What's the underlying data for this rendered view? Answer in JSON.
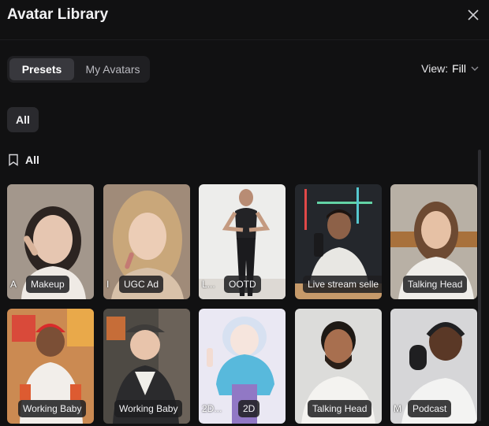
{
  "header": {
    "title": "Avatar Library"
  },
  "tabs": [
    {
      "label": "Presets"
    },
    {
      "label": "My Avatars"
    }
  ],
  "view": {
    "label": "View:",
    "value": "Fill"
  },
  "filter_chip": {
    "label": "All"
  },
  "section": {
    "title": "All"
  },
  "cards": [
    {
      "prefix": "A",
      "label": "Makeup"
    },
    {
      "prefix": "I",
      "label": "UGC Ad"
    },
    {
      "prefix": "L...",
      "label": "OOTD"
    },
    {
      "prefix": "",
      "label": "Live stream selle"
    },
    {
      "prefix": "",
      "label": "Talking Head"
    },
    {
      "prefix": "",
      "label": "Working Baby"
    },
    {
      "prefix": "",
      "label": "Working Baby"
    },
    {
      "prefix": "2D...",
      "label": "2D"
    },
    {
      "prefix": "",
      "label": "Talking Head"
    },
    {
      "prefix": "M",
      "label": "Podcast"
    }
  ]
}
